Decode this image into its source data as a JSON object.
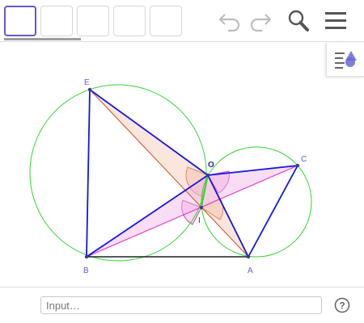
{
  "toolbar": {
    "tool_slots": [
      "tool-slot-1",
      "tool-slot-2",
      "tool-slot-3",
      "tool-slot-4",
      "tool-slot-5"
    ],
    "icons": {
      "undo": "undo-icon",
      "redo": "redo-icon",
      "search": "search-icon",
      "menu": "menu-icon"
    }
  },
  "stylebar": {
    "icon": "stylebar-toggle-icon"
  },
  "construction": {
    "points": {
      "E": "E",
      "O": "O",
      "C": "C",
      "I": "I",
      "B": "B",
      "A": "A"
    },
    "colors": {
      "segment": "#1414e6",
      "circle": "#32d232",
      "line": "#e633c8",
      "angle_fill": "#f5c8b4",
      "angle_stroke": "#c85a28",
      "point": "#3c3c8c",
      "label": "#5b5bd6"
    }
  },
  "inputbar": {
    "placeholder": "Input…",
    "help_icon": "help-icon"
  }
}
